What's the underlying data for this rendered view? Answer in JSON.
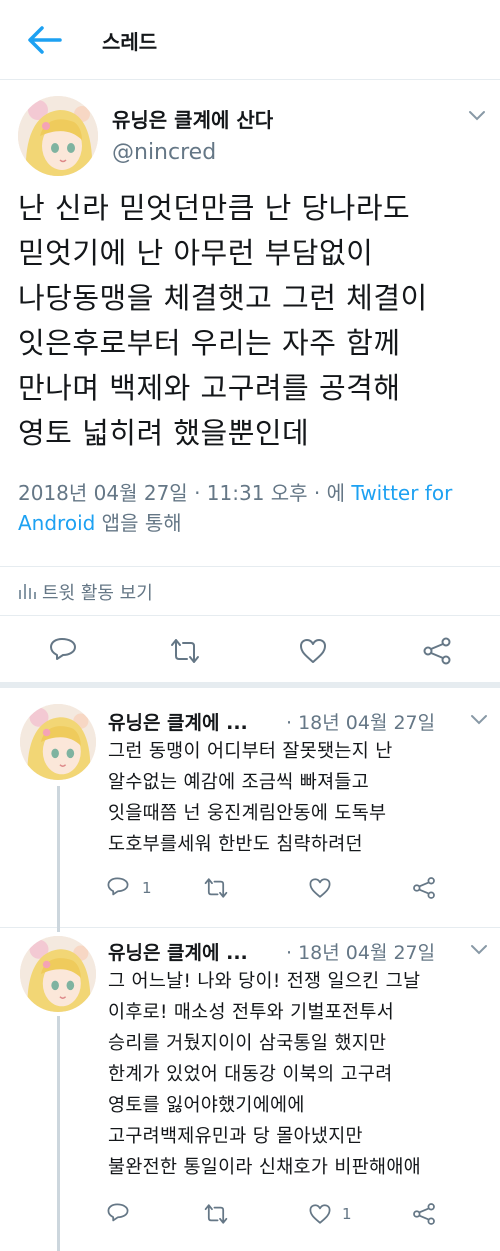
{
  "header": {
    "title": "스레드"
  },
  "main_tweet": {
    "display_name": "유닝은 클계에 산다",
    "handle": "@nincred",
    "text": "난 신라 믿엇던만큼 난 당나라도\n믿엇기에 난 아무런 부담없이\n나당동맹을 체결햇고 그런 체결이\n잇은후로부터 우리는 자주 함께\n만나며 백제와 고구려를 공격해\n영토 넓히려 했을뿐인데",
    "timestamp": "2018년 04월 27일 · 11:31 오후 · 에 ",
    "client_link": "Twitter for Android",
    "client_suffix": " 앱을 통해",
    "stats_label": "트윗 활동 보기"
  },
  "replies": [
    {
      "display_name": "유닝은 클계에 ...",
      "date": "· 18년 04월 27일",
      "text": "그런 동맹이 어디부터 잘못됏는지 난\n알수없는 예감에 조금씩 빠져들고\n잇을때쯤 넌 웅진계림안동에 도독부\n도호부를세워 한반도 침략하려던",
      "reply_count": "1",
      "like_count": ""
    },
    {
      "display_name": "유닝은 클계에 ...",
      "date": "· 18년 04월 27일",
      "text": "그 어느날! 나와 당이! 전쟁 일으킨 그날\n이후로! 매소성 전투와 기벌포전투서\n승리를 거뒀지이이 삼국통일 했지만\n한계가 있었어 대동강 이북의 고구려\n영토를 잃어야했기에에에\n고구려백제유민과 당 몰아냈지만\n불완전한 통일이라 신채호가 비판해애애",
      "reply_count": "",
      "like_count": "1"
    }
  ],
  "icons": {
    "back": "arrow-left-icon",
    "caret": "chevron-down-icon",
    "stats": "bar-chart-icon",
    "reply": "reply-icon",
    "retweet": "retweet-icon",
    "like": "heart-icon",
    "share": "share-icon"
  },
  "colors": {
    "accent": "#1da1f2",
    "secondary_text": "#657786",
    "divider": "#e6ecf0",
    "thread_line": "#ccd6dd"
  }
}
